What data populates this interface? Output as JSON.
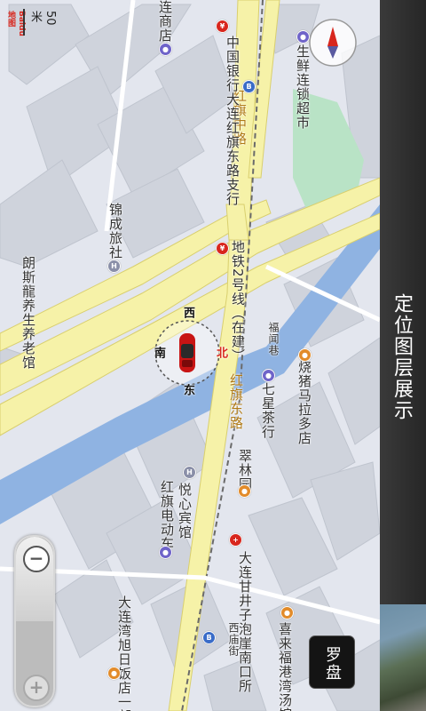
{
  "app": {
    "title": "定位图层展示"
  },
  "controls": {
    "compass_label": "罗盘",
    "zoom_out_symbol": "−",
    "zoom_in_symbol": "+"
  },
  "scale": {
    "text": "50米",
    "logo": "Baidu地图"
  },
  "location": {
    "direction_labels": {
      "north": "北",
      "south": "南",
      "west": "西",
      "east": "东"
    }
  },
  "map_labels": {
    "roads": [
      {
        "text": "红旗中路"
      },
      {
        "text": "红旗东路"
      }
    ],
    "metro": {
      "text": "地铁2号线（在建）"
    },
    "small_roads": [
      {
        "text": "福闻巷"
      },
      {
        "text": "西庙街"
      }
    ],
    "pois": [
      {
        "text": "连商店"
      },
      {
        "text": "中国银行大连红旗东路支行"
      },
      {
        "text": "生鲜连锁超市"
      },
      {
        "text": "锦成旅社"
      },
      {
        "text": "朗斯龍养生养老馆"
      },
      {
        "text": "烧猪马拉多店"
      },
      {
        "text": "七星茶行"
      },
      {
        "text": "翠林园"
      },
      {
        "text": "悦心宾馆"
      },
      {
        "text": "红旗电动车"
      },
      {
        "text": "大连甘井子泡崖南口所"
      },
      {
        "text": "大连湾旭日饭店一部"
      },
      {
        "text": "喜来福港湾汤馆"
      }
    ]
  },
  "colors": {
    "accent_red": "#d8261d",
    "titlebar": "#2d2d2d",
    "road_yellow": "#f6f2a8",
    "water": "#8fb3e2",
    "park": "#b9e3c6"
  }
}
